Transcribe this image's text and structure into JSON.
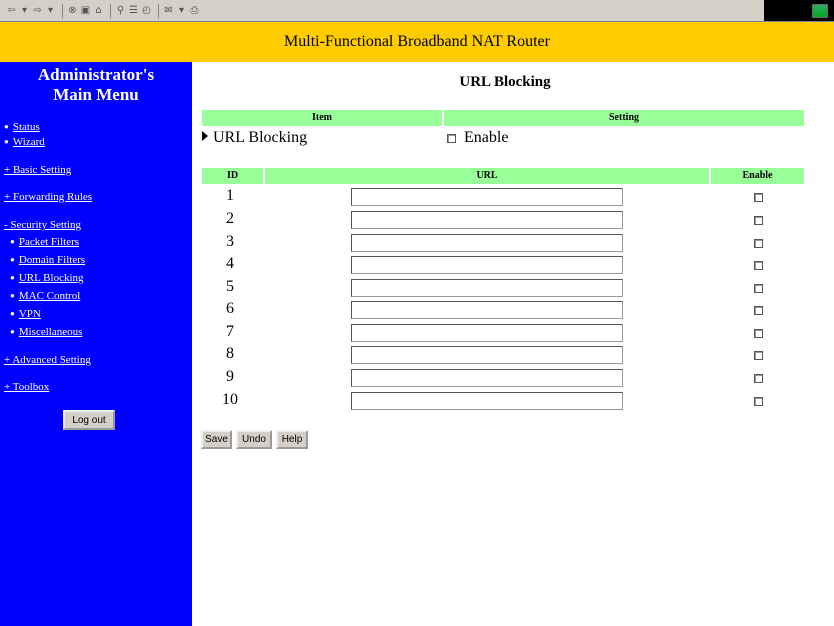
{
  "browser": {
    "toolbar_icons": [
      "back-icon",
      "forward-icon",
      "stop-icon",
      "refresh-icon",
      "home-icon",
      "search-icon",
      "favorites-icon",
      "history-icon",
      "mail-icon",
      "print-icon",
      "edit-icon"
    ],
    "toolbar_glyphs": [
      "⇦",
      "▾",
      "⇨",
      "▾",
      "⊗",
      "▣",
      "⌂",
      "⚲",
      "☰",
      "◴",
      "✉",
      "▾",
      "⎙"
    ]
  },
  "header": {
    "title": "Multi-Functional Broadband NAT Router"
  },
  "sidebar": {
    "title_line1": "Administrator's",
    "title_line2": "Main Menu",
    "top_links": [
      "Status",
      "Wizard"
    ],
    "sections": [
      {
        "label": "+ Basic Setting"
      },
      {
        "label": "+ Forwarding Rules"
      },
      {
        "label": "- Security Setting"
      },
      {
        "label": "+ Advanced Setting"
      },
      {
        "label": "+ Toolbox"
      }
    ],
    "security_items": [
      "Packet Filters",
      "Domain Filters",
      "URL Blocking",
      "MAC Control",
      "VPN",
      "Miscellaneous"
    ],
    "logout_label": "Log out"
  },
  "main": {
    "page_title": "URL Blocking",
    "settings_header": {
      "item": "Item",
      "setting": "Setting"
    },
    "url_blocking_label": "URL Blocking",
    "enable_label": "Enable",
    "enable_checked": false,
    "table_header": {
      "id": "ID",
      "url": "URL",
      "enable": "Enable"
    },
    "rows": [
      {
        "id": "1",
        "url": "",
        "enabled": false
      },
      {
        "id": "2",
        "url": "",
        "enabled": false
      },
      {
        "id": "3",
        "url": "",
        "enabled": false
      },
      {
        "id": "4",
        "url": "",
        "enabled": false
      },
      {
        "id": "5",
        "url": "",
        "enabled": false
      },
      {
        "id": "6",
        "url": "",
        "enabled": false
      },
      {
        "id": "7",
        "url": "",
        "enabled": false
      },
      {
        "id": "8",
        "url": "",
        "enabled": false
      },
      {
        "id": "9",
        "url": "",
        "enabled": false
      },
      {
        "id": "10",
        "url": "",
        "enabled": false
      }
    ],
    "buttons": {
      "save": "Save",
      "undo": "Undo",
      "help": "Help"
    }
  },
  "colors": {
    "title_bar": "#ffcc00",
    "sidebar": "#0000ff",
    "table_header": "#99ff99"
  }
}
